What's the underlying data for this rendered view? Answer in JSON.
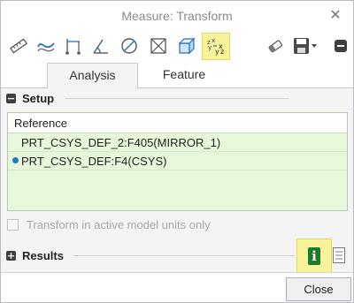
{
  "window": {
    "title": "Measure: Transform",
    "close_glyph": "✕"
  },
  "toolbar": {
    "icons": [
      "length-icon",
      "distance-icon",
      "angle-icon",
      "area-icon",
      "diameter-icon",
      "volume-icon",
      "transform-icon"
    ],
    "save_icon": "save-icon"
  },
  "tabs": [
    {
      "label": "Analysis",
      "active": true
    },
    {
      "label": "Feature",
      "active": false
    }
  ],
  "setup": {
    "label": "Setup",
    "toggle": "−"
  },
  "reference": {
    "header": "Reference",
    "rows": [
      {
        "text": "PRT_CSYS_DEF_2:F405(MIRROR_1)",
        "selected": false
      },
      {
        "text": "PRT_CSYS_DEF:F4(CSYS)",
        "selected": true
      }
    ]
  },
  "transform_option": {
    "label": "Transform in active model units only",
    "checked": false,
    "enabled": false
  },
  "results": {
    "label": "Results",
    "toggle": "+",
    "info_glyph": "i"
  },
  "footer": {
    "close_label": "Close"
  },
  "colors": {
    "highlight": "#f7f39a",
    "panel_green": "#e7f7d9",
    "info_green": "#1d7a2b",
    "bullet_blue": "#1f7bbf"
  }
}
